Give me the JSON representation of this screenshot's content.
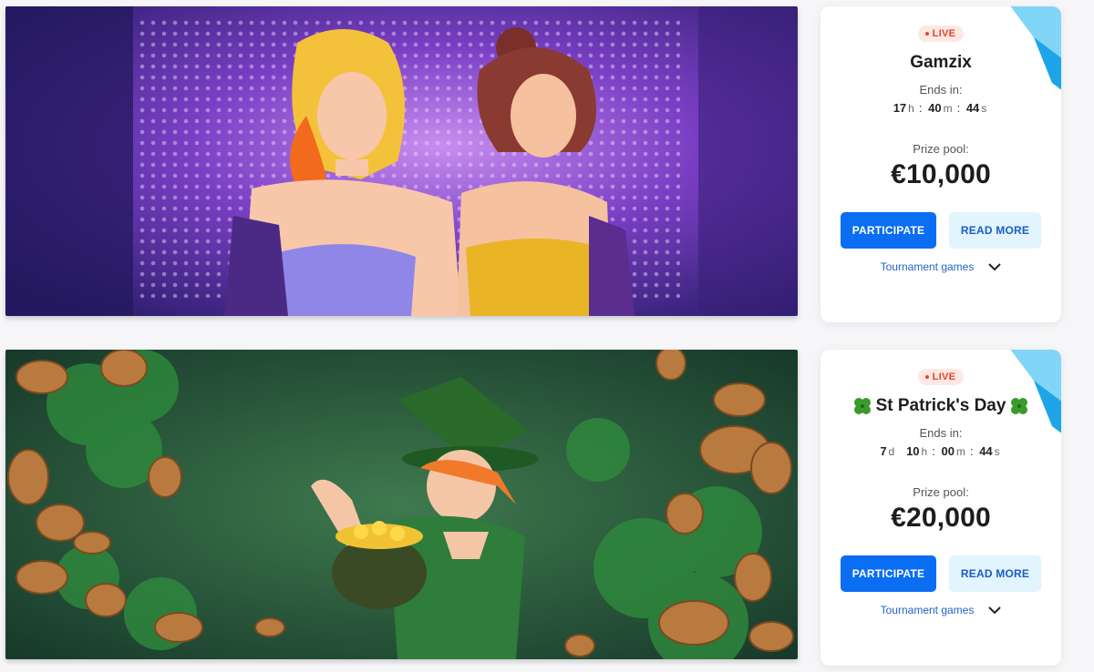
{
  "tournaments": [
    {
      "status": "LIVE",
      "title": "Gamzix",
      "ends_label": "Ends in:",
      "timer": {
        "d": null,
        "h": "17",
        "m": "40",
        "s": "44"
      },
      "units": {
        "d": "d",
        "h": "h",
        "m": "m",
        "s": "s"
      },
      "prize_label": "Prize pool:",
      "prize": "€10,000",
      "participate_label": "PARTICIPATE",
      "read_more_label": "READ MORE",
      "games_label": "Tournament games"
    },
    {
      "status": "LIVE",
      "title": "St Patrick's Day",
      "ends_label": "Ends in:",
      "timer": {
        "d": "7",
        "h": "10",
        "m": "00",
        "s": "44"
      },
      "units": {
        "d": "d",
        "h": "h",
        "m": "m",
        "s": "s"
      },
      "prize_label": "Prize pool:",
      "prize": "€20,000",
      "participate_label": "PARTICIPATE",
      "read_more_label": "READ MORE",
      "games_label": "Tournament games"
    }
  ],
  "icons": {
    "live": "live-dot-icon",
    "clover": "four-leaf-clover-icon",
    "chevron": "chevron-down-icon"
  },
  "colors": {
    "primary_button": "#0a6ef2",
    "secondary_button": "#e2f4fd",
    "live_badge": "#e5432c",
    "link": "#2463c6"
  }
}
